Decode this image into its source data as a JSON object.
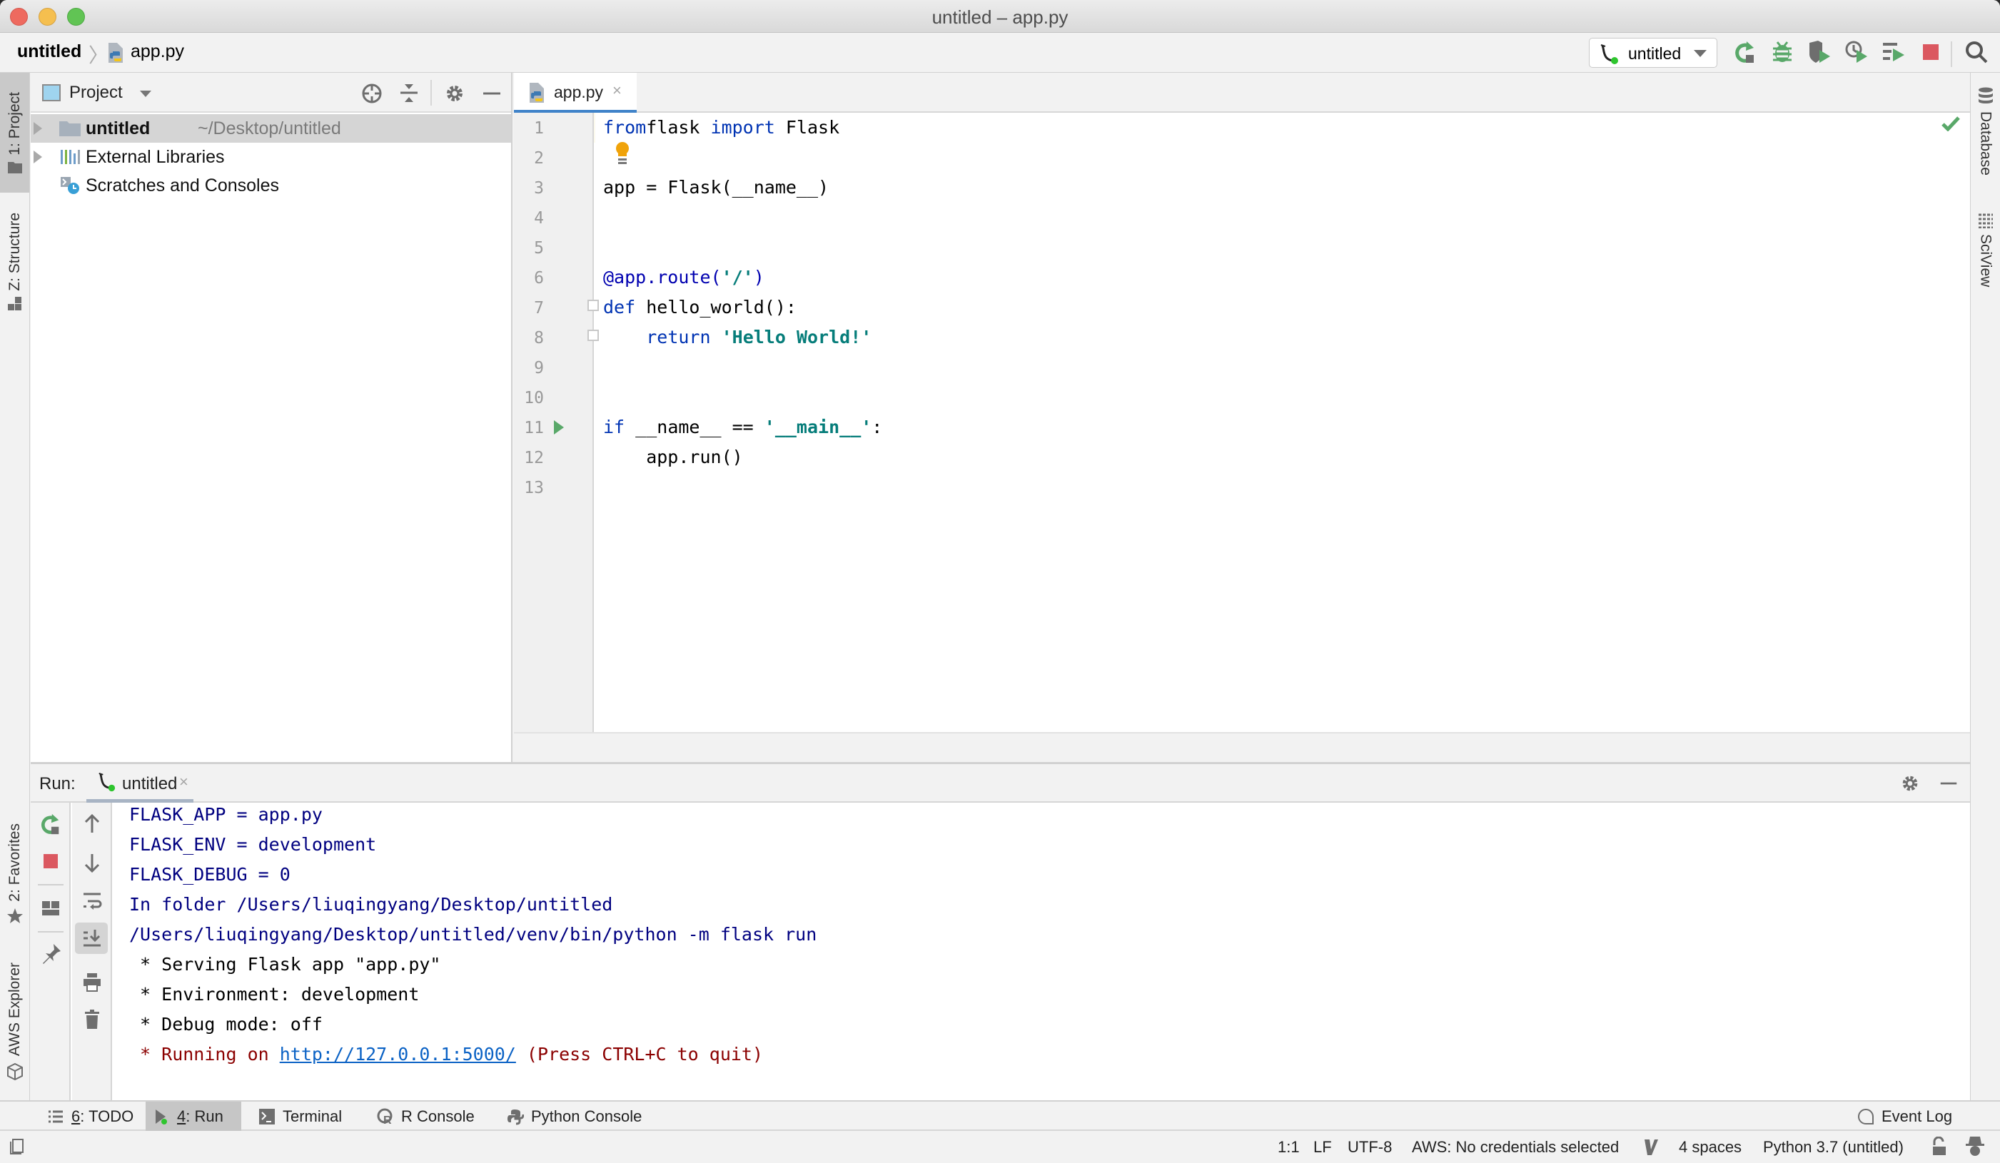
{
  "window": {
    "title": "untitled – app.py"
  },
  "navbar": {
    "project": "untitled",
    "separator": "〉",
    "file": "app.py",
    "run_config": "untitled",
    "toolbar_icons": [
      "rerun-icon",
      "debug-icon",
      "coverage-icon",
      "profile-icon",
      "run-concurrency-icon",
      "stop-icon",
      "search-icon"
    ]
  },
  "left_strip": {
    "tabs": [
      {
        "label": "1: Project",
        "active": true
      },
      {
        "label": "Z: Structure",
        "active": false
      },
      {
        "label": "2: Favorites",
        "active": false
      },
      {
        "label": "AWS Explorer",
        "active": false
      }
    ]
  },
  "right_strip": {
    "tabs": [
      {
        "label": "Database"
      },
      {
        "label": "SciView"
      }
    ]
  },
  "project_panel": {
    "title": "Project",
    "tree": [
      {
        "name": "untitled",
        "path": "~/Desktop/untitled",
        "selected": true,
        "expandable": true
      },
      {
        "name": "External Libraries",
        "path": "",
        "selected": false,
        "expandable": true
      },
      {
        "name": "Scratches and Consoles",
        "path": "",
        "selected": false,
        "expandable": false
      }
    ]
  },
  "editor": {
    "tab": "app.py",
    "close_glyph": "×",
    "line_numbers": [
      "1",
      "2",
      "3",
      "4",
      "5",
      "6",
      "7",
      "8",
      "9",
      "10",
      "11",
      "12",
      "13"
    ],
    "lines": [
      {
        "n": 1,
        "tokens": [
          [
            "kw",
            "from"
          ],
          [
            "",
            "flask "
          ],
          [
            "kw",
            "import"
          ],
          [
            "",
            " Flask"
          ]
        ]
      },
      {
        "n": 2,
        "tokens": []
      },
      {
        "n": 3,
        "tokens": [
          [
            "",
            "app = Flask(__name__)"
          ]
        ]
      },
      {
        "n": 4,
        "tokens": []
      },
      {
        "n": 5,
        "tokens": []
      },
      {
        "n": 6,
        "tokens": [
          [
            "deco",
            "@app.route("
          ],
          [
            "str2",
            "'/'"
          ],
          [
            "deco",
            ")"
          ]
        ]
      },
      {
        "n": 7,
        "tokens": [
          [
            "kw",
            "def"
          ],
          [
            "",
            " hello_world():"
          ]
        ]
      },
      {
        "n": 8,
        "tokens": [
          [
            "",
            "    "
          ],
          [
            "kw",
            "return"
          ],
          [
            "",
            " "
          ],
          [
            "str2",
            "'Hello World!'"
          ]
        ]
      },
      {
        "n": 9,
        "tokens": []
      },
      {
        "n": 10,
        "tokens": []
      },
      {
        "n": 11,
        "tokens": [
          [
            "kw",
            "if"
          ],
          [
            "",
            " __name__ == "
          ],
          [
            "str2",
            "'__main__'"
          ],
          [
            "",
            ":"
          ]
        ]
      },
      {
        "n": 12,
        "tokens": [
          [
            "",
            "    app.run()"
          ]
        ]
      },
      {
        "n": 13,
        "tokens": []
      }
    ]
  },
  "run_panel": {
    "label": "Run:",
    "tab": "untitled",
    "close_glyph": "×",
    "console": [
      {
        "style": "c-sys",
        "text": "FLASK_APP = app.py"
      },
      {
        "style": "c-sys",
        "text": "FLASK_ENV = development"
      },
      {
        "style": "c-sys",
        "text": "FLASK_DEBUG = 0"
      },
      {
        "style": "c-sys",
        "text": "In folder /Users/liuqingyang/Desktop/untitled"
      },
      {
        "style": "c-sys",
        "text": "/Users/liuqingyang/Desktop/untitled/venv/bin/python -m flask run"
      },
      {
        "style": "c-out",
        "text": " * Serving Flask app \"app.py\""
      },
      {
        "style": "c-out",
        "text": " * Environment: development"
      },
      {
        "style": "c-out",
        "text": " * Debug mode: off"
      },
      {
        "style": "c-err",
        "text": " * Running on ",
        "link": "http://127.0.0.1:5000/",
        "after": " (Press CTRL+C to quit)"
      }
    ]
  },
  "bottom_tabs": [
    {
      "key": "6",
      "label": ": TODO",
      "active": false
    },
    {
      "key": "4",
      "label": ": Run",
      "active": true
    },
    {
      "key": "",
      "label": "Terminal",
      "active": false
    },
    {
      "key": "",
      "label": "R Console",
      "active": false
    },
    {
      "key": "",
      "label": "Python Console",
      "active": false
    }
  ],
  "event_log": "Event Log",
  "status_bar": {
    "position": "1:1",
    "line_sep": "LF",
    "encoding": "UTF-8",
    "aws": "AWS: No credentials selected",
    "indent": "4 spaces",
    "interpreter": "Python 3.7 (untitled)"
  },
  "colors": {
    "accent_tab": "#4083c9",
    "run_green": "#59a869",
    "stop_red": "#db5860",
    "keyword": "#0033b3",
    "string": "#067d7a",
    "console_system": "#000080",
    "console_error": "#8b0000",
    "link": "#0b62c5"
  }
}
